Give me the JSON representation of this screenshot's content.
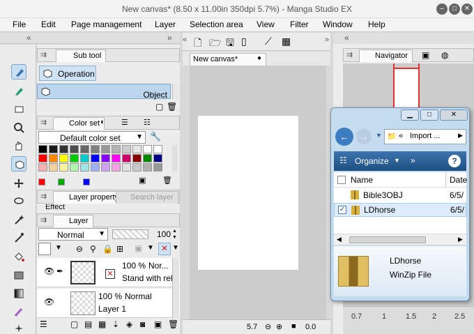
{
  "window": {
    "title": "New canvas* (8.50 x 11.00in 350dpi 5.7%) - Manga Studio EX"
  },
  "menu": [
    "File",
    "Edit",
    "Page management",
    "Layer",
    "Selection area",
    "View",
    "Filter",
    "Window",
    "Help"
  ],
  "subtool": {
    "tab": "Sub tool",
    "operation_label": "Operation",
    "object_label": "Object"
  },
  "colorset": {
    "tab": "Color set",
    "dropdown": "Default color set",
    "swatches": [
      "#000000",
      "#1a1a1a",
      "#333333",
      "#4d4d4d",
      "#666666",
      "#808080",
      "#999999",
      "#b3b3b3",
      "#cccccc",
      "#e6e6e6",
      "#ffffff",
      "#ffffff",
      "#ff0000",
      "#ff8800",
      "#ffff00",
      "#00cc00",
      "#00cccc",
      "#0000ff",
      "#8800ff",
      "#ff00ff",
      "#cc0066",
      "#880000",
      "#008800",
      "#000088",
      "#f5b0b0",
      "#f5d0a0",
      "#f5f5a0",
      "#b0f5b0",
      "#a0e5e5",
      "#a0b0f5",
      "#d0a0f5",
      "#f5a0e5",
      "#e0e0e0",
      "#c8c8c8",
      "#b0b0b0",
      "#989898"
    ]
  },
  "layerprop": {
    "tab": "Layer property",
    "search_tab": "Search layer",
    "effect_label": "Effect"
  },
  "layer": {
    "tab": "Layer",
    "blend": "Normal",
    "opacity": "100",
    "rows": [
      {
        "percent": "100 %",
        "mode": "Nor...",
        "name": "Stand with rela"
      },
      {
        "percent": "100 %",
        "mode": "Normal",
        "name": "Layer 1"
      }
    ]
  },
  "canvas": {
    "tab": "New canvas*",
    "zoom": "5.7",
    "rotation": "0.0"
  },
  "navigator": {
    "tab": "Navigator"
  },
  "explorer": {
    "address": "Import ...",
    "organize": "Organize",
    "col_name": "Name",
    "col_date": "Date",
    "files": [
      {
        "name": "Bible3OBJ",
        "date": "6/5/"
      },
      {
        "name": "LDhorse",
        "date": "6/5/"
      }
    ],
    "preview_name": "LDhorse",
    "preview_type": "WinZip File"
  },
  "ruler_values": [
    "0.7",
    "1",
    "1.5",
    "2",
    "2.5"
  ],
  "colors": {
    "accent": "#4a7fb5",
    "selected": "#cfe3f5",
    "navigator_red": "#e03030"
  }
}
